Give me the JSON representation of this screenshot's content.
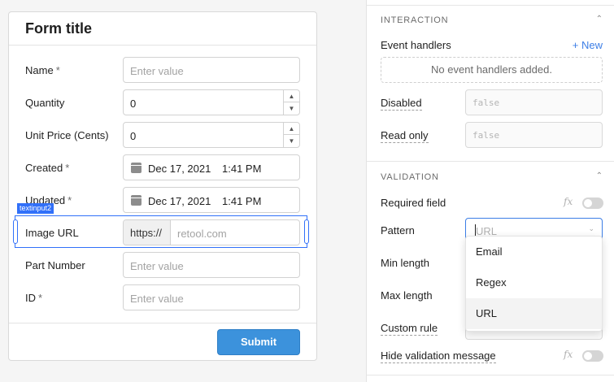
{
  "form": {
    "title": "Form title",
    "fields": {
      "name": {
        "label": "Name",
        "required": "*",
        "placeholder": "Enter value"
      },
      "quantity": {
        "label": "Quantity",
        "value": "0"
      },
      "unit_price": {
        "label": "Unit Price (Cents)",
        "value": "0"
      },
      "created": {
        "label": "Created",
        "required": "*",
        "date": "Dec 17, 2021",
        "time": "1:41 PM"
      },
      "updated": {
        "label": "Updated",
        "required": "*",
        "date": "Dec 17, 2021",
        "time": "1:41 PM"
      },
      "image_url": {
        "label": "Image URL",
        "prefix": "https://",
        "placeholder": "retool.com",
        "component_tag": "textinput2"
      },
      "part_number": {
        "label": "Part Number",
        "placeholder": "Enter value"
      },
      "id": {
        "label": "ID",
        "required": "*",
        "placeholder": "Enter value"
      }
    },
    "submit_label": "Submit"
  },
  "inspector": {
    "interaction": {
      "title": "INTERACTION",
      "event_handlers_label": "Event handlers",
      "new_label": "+ New",
      "empty_text": "No event handlers added.",
      "disabled_label": "Disabled",
      "disabled_value": "false",
      "read_only_label": "Read only",
      "read_only_value": "false"
    },
    "validation": {
      "title": "VALIDATION",
      "required_field_label": "Required field",
      "required_field_on": false,
      "pattern_label": "Pattern",
      "pattern_placeholder": "URL",
      "pattern_options": [
        "Email",
        "Regex",
        "URL"
      ],
      "pattern_highlighted": "URL",
      "min_length_label": "Min length",
      "max_length_label": "Max length",
      "custom_rule_label": "Custom rule",
      "hide_validation_label": "Hide validation message",
      "hide_validation_on": false,
      "fx_symbol": "fx"
    }
  },
  "colors": {
    "accent": "#3c7ee6",
    "selection": "#3170f9",
    "submit": "#3c92dc"
  }
}
